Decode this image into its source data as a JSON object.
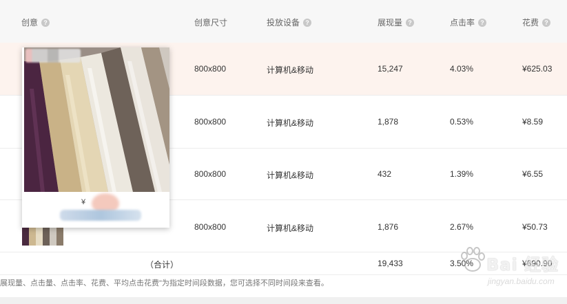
{
  "header": {
    "creative": "创意",
    "size": "创意尺寸",
    "device": "投放设备",
    "impressions": "展现量",
    "ctr": "点击率",
    "cost": "花费",
    "help_glyph": "?"
  },
  "rows": [
    {
      "size": "800x800",
      "device": "计算机&移动",
      "impressions": "15,247",
      "ctr": "4.03%",
      "cost": "¥625.03"
    },
    {
      "size": "800x800",
      "device": "计算机&移动",
      "impressions": "1,878",
      "ctr": "0.53%",
      "cost": "¥8.59"
    },
    {
      "size": "800x800",
      "device": "计算机&移动",
      "impressions": "432",
      "ctr": "1.39%",
      "cost": "¥6.55"
    },
    {
      "size": "800x800",
      "device": "计算机&移动",
      "impressions": "1,876",
      "ctr": "2.67%",
      "cost": "¥50.73"
    }
  ],
  "total": {
    "label": "（合计）",
    "impressions": "19,433",
    "ctr": "3.50%",
    "cost": "¥690.90"
  },
  "note": "展现量、点击量、点击率、花费、平均点击花费\"为指定时间段数据，您可选择不同时间段来查看。",
  "popup": {
    "price_prefix": "¥"
  },
  "watermark": {
    "text": "Bai 经验",
    "url": "jingyan.baidu.com"
  },
  "colors": {
    "highlight_row": "#fdf3ee",
    "header_bg": "#f7f7f7"
  }
}
